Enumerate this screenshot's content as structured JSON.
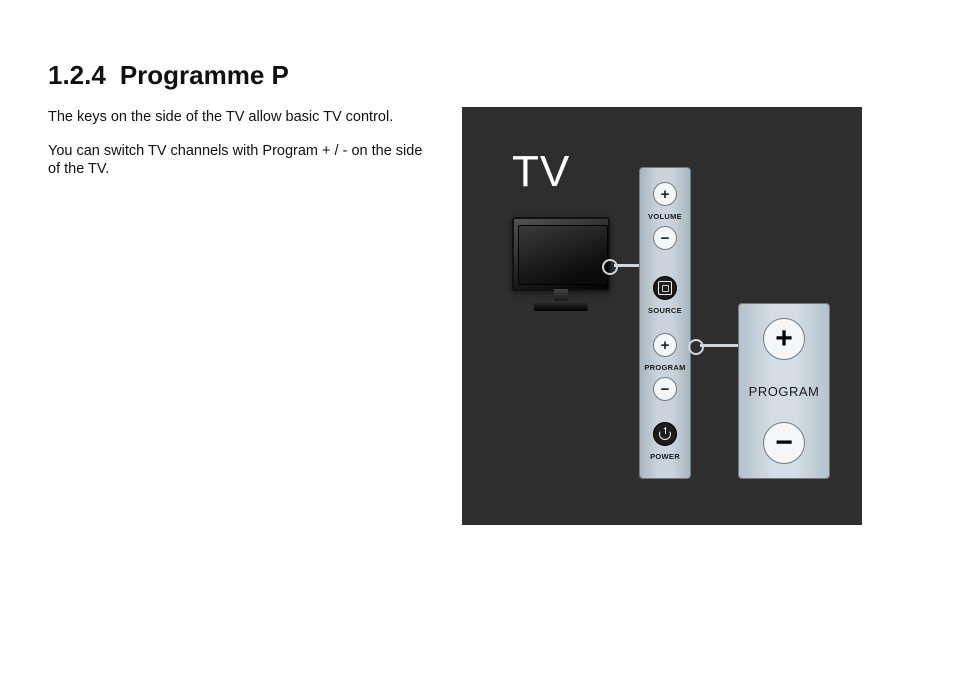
{
  "heading": {
    "number": "1.2.4",
    "title": "Programme P"
  },
  "paragraphs": {
    "p1": "The keys on the side of the TV allow basic TV control.",
    "p2": "You can switch TV channels with Program + / - on the side of the TV."
  },
  "illustration": {
    "tv_label": "TV",
    "strip": {
      "volume": {
        "plus": "+",
        "minus": "−",
        "label": "VOLUME"
      },
      "source": {
        "label": "SOURCE"
      },
      "program": {
        "plus": "+",
        "minus": "−",
        "label": "PROGRAM"
      },
      "power": {
        "label": "POWER"
      }
    },
    "program_panel": {
      "plus": "+",
      "minus": "−",
      "label": "PROGRAM"
    }
  }
}
